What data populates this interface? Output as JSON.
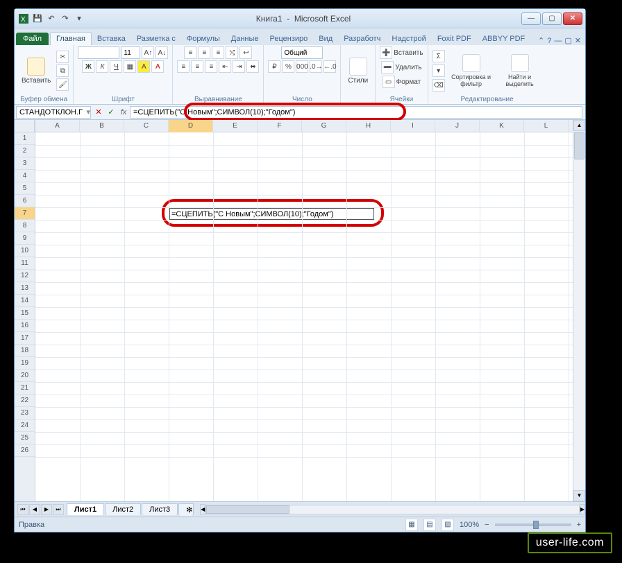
{
  "titlebar": {
    "book": "Книга1",
    "app": "Microsoft Excel"
  },
  "file_tab": "Файл",
  "ribbon_tabs": [
    "Главная",
    "Вставка",
    "Разметка с",
    "Формулы",
    "Данные",
    "Рецензиро",
    "Вид",
    "Разработч",
    "Надстрой",
    "Foxit PDF",
    "ABBYY PDF"
  ],
  "ribbon_active": 0,
  "groups": {
    "clipboard": {
      "paste": "Вставить",
      "label": "Буфер обмена"
    },
    "font": {
      "name": "",
      "size": "11",
      "label": "Шрифт"
    },
    "alignment": {
      "label": "Выравнивание"
    },
    "number": {
      "format": "Общий",
      "label": "Число"
    },
    "styles": {
      "btn": "Стили",
      "label": ""
    },
    "cells": {
      "insert": "Вставить",
      "delete": "Удалить",
      "format": "Формат",
      "label": "Ячейки"
    },
    "editing": {
      "sort": "Сортировка и фильтр",
      "find": "Найти и выделить",
      "label": "Редактирование"
    }
  },
  "name_box": "СТАНДОТКЛОН.Г",
  "formula": "=СЦЕПИТЬ(\"С Новым\";СИМВОЛ(10);\"Годом\")",
  "cell_content": "=СЦЕПИТЬ(\"С Новым\";СИМВОЛ(10);\"Годом\")",
  "columns": [
    "A",
    "B",
    "C",
    "D",
    "E",
    "F",
    "G",
    "H",
    "I",
    "J",
    "K",
    "L"
  ],
  "rows": [
    "1",
    "2",
    "3",
    "4",
    "5",
    "6",
    "7",
    "8",
    "9",
    "10",
    "11",
    "12",
    "13",
    "14",
    "15",
    "16",
    "17",
    "18",
    "19",
    "20",
    "21",
    "22",
    "23",
    "24",
    "25",
    "26"
  ],
  "active_col": 3,
  "active_row": 6,
  "sheets": [
    "Лист1",
    "Лист2",
    "Лист3"
  ],
  "active_sheet": 0,
  "status": "Правка",
  "zoom": "100%",
  "watermark": "user-life.com"
}
